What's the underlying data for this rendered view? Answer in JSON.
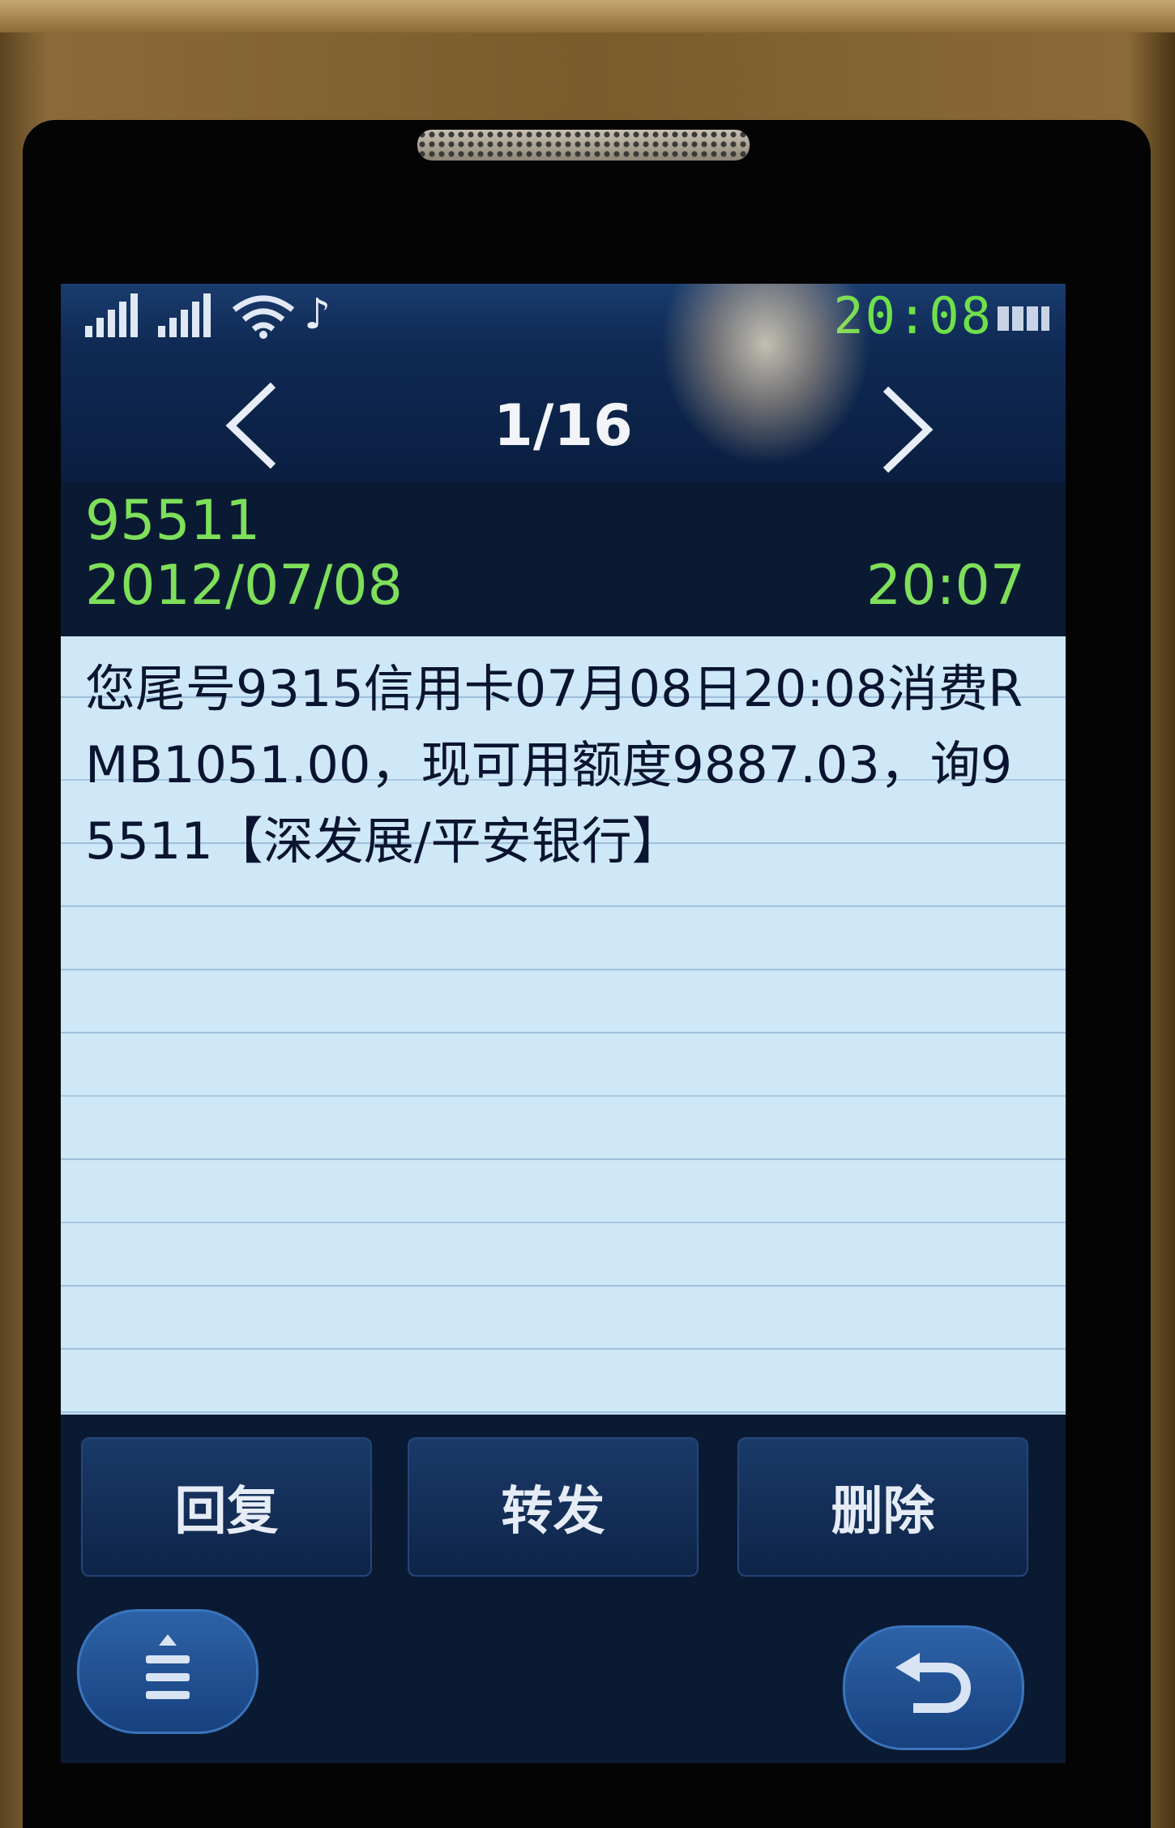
{
  "status_bar": {
    "time": "20:08",
    "icons": [
      "signal-icon",
      "signal-icon",
      "wifi-icon",
      "music-note-icon",
      "battery-icon"
    ],
    "time_color": "#6fe04a"
  },
  "nav": {
    "page_counter": "1/16",
    "prev_icon": "chevron-left-icon",
    "next_icon": "chevron-right-icon"
  },
  "message": {
    "sender": "95511",
    "date": "2012/07/08",
    "time": "20:07",
    "body": "您尾号9315信用卡07月08日20:08消费RMB1051.00，现可用额度9887.03，询95511【深发展/平安银行】"
  },
  "actions": {
    "reply": "回复",
    "forward": "转发",
    "delete": "删除"
  },
  "bottom": {
    "menu_icon": "menu-icon",
    "back_icon": "back-arrow-icon"
  },
  "colors": {
    "accent_green": "#7ee05a",
    "screen_bg": "#0b1a33",
    "message_bg": "#cfe8f8"
  }
}
